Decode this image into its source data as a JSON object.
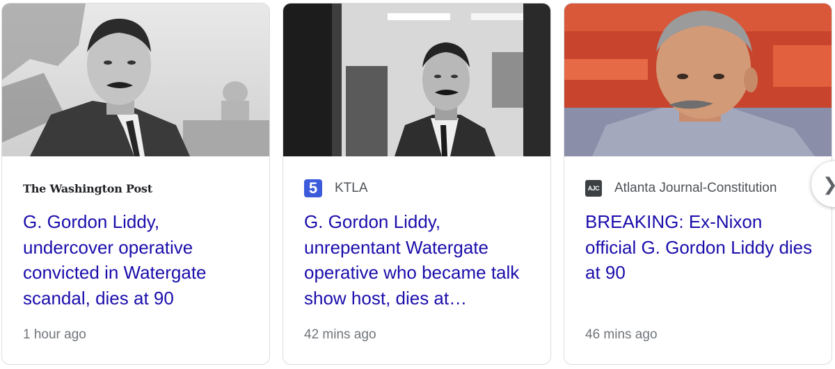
{
  "cards": [
    {
      "source": "The Washington Post",
      "headline": "G. Gordon Liddy, undercover operative convicted in Watergate scandal, dies at 90",
      "time": "1 hour ago"
    },
    {
      "source": "KTLA",
      "favicon": "5",
      "headline": "G. Gordon Liddy, unrepentant Watergate operative who became talk show host, dies at…",
      "time": "42 mins ago"
    },
    {
      "source": "Atlanta Journal-Constitution",
      "favicon": "AJC",
      "headline": "BREAKING: Ex-Nixon official G. Gordon Liddy dies at 90",
      "time": "46 mins ago"
    }
  ],
  "colors": {
    "headline": "#1a0dab",
    "meta": "#70757a",
    "ktla_brand": "#3b5bdb"
  },
  "icons": {
    "next": "chevron-right-icon"
  }
}
